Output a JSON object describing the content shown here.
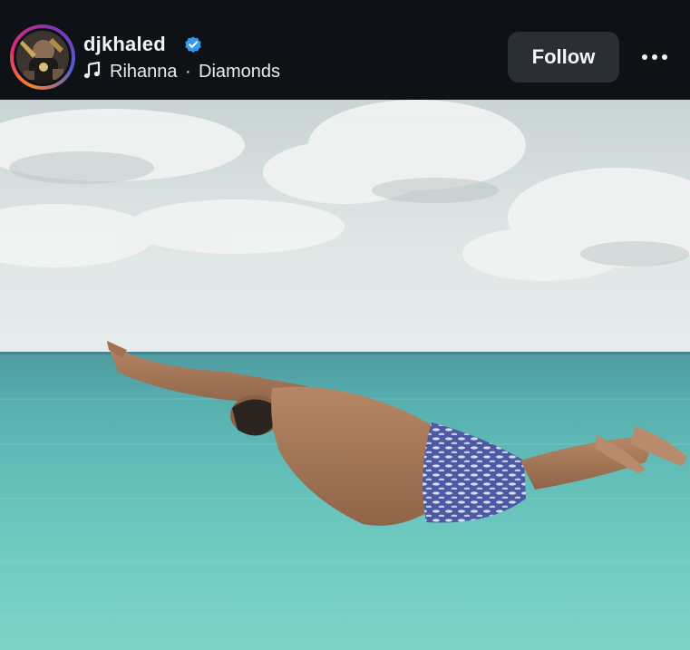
{
  "post_header": {
    "username": "djkhaled",
    "verified": true,
    "audio_artist": "Rihanna",
    "audio_separator": "·",
    "audio_song": "Diamonds",
    "follow_label": "Follow",
    "more_icon": "more-horizontal-icon"
  },
  "icons": {
    "verified": "verified-badge-icon",
    "music": "music-note-icon"
  },
  "colors": {
    "background": "#0e1116",
    "follow_button_bg": "#2a2e35",
    "verified_badge": "#3897f0",
    "text": "#f2f3f5"
  },
  "photo": {
    "subject": "man diving over turquoise ocean",
    "sky": "overcast clouds"
  }
}
